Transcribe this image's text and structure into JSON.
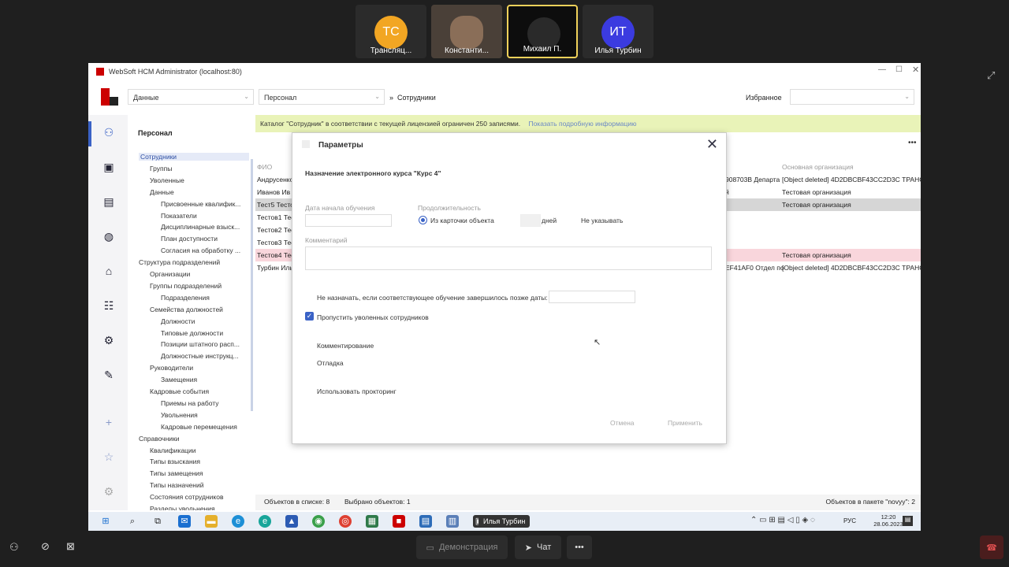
{
  "conference": {
    "participants": [
      {
        "initials": "ТС",
        "name": "Трансляц...",
        "color": "#f2a623"
      },
      {
        "initials": "",
        "name": "Константи...",
        "color": "#555555"
      },
      {
        "initials": "",
        "name": "Михаил П.",
        "color": "#111111"
      },
      {
        "initials": "ИТ",
        "name": "Илья Турбин",
        "color": "#3b3be0"
      }
    ],
    "demo_label": "Демонстрация",
    "chat_label": "Чат",
    "more_label": "•••",
    "taskbar_tooltip": "Илья Турбин"
  },
  "window": {
    "title": "WebSoft HCM Administrator (localhost:80)",
    "toolbar": {
      "data_combo": "Данные",
      "personal_combo": "Персонал",
      "breadcrumb_sep": "»",
      "breadcrumb": "Сотрудники",
      "favorites_label": "Избранное"
    }
  },
  "tree": {
    "header": "Персонал",
    "items": [
      {
        "label": "Сотрудники",
        "level": 0
      },
      {
        "label": "Группы",
        "level": 1
      },
      {
        "label": "Уволенные",
        "level": 1
      },
      {
        "label": "Данные",
        "level": 1
      },
      {
        "label": "Присвоенные квалифик...",
        "level": 2
      },
      {
        "label": "Показатели",
        "level": 2
      },
      {
        "label": "Дисциплинарные взыск...",
        "level": 2
      },
      {
        "label": "План доступности",
        "level": 2
      },
      {
        "label": "Согласия на обработку ...",
        "level": 2
      },
      {
        "label": "Структура подразделений",
        "level": 0
      },
      {
        "label": "Организации",
        "level": 1
      },
      {
        "label": "Группы подразделений",
        "level": 1
      },
      {
        "label": "Подразделения",
        "level": 2
      },
      {
        "label": "Семейства должностей",
        "level": 1
      },
      {
        "label": "Должности",
        "level": 2
      },
      {
        "label": "Типовые должности",
        "level": 2
      },
      {
        "label": "Позиции штатного расп...",
        "level": 2
      },
      {
        "label": "Должностные инструкц...",
        "level": 2
      },
      {
        "label": "Руководители",
        "level": 1
      },
      {
        "label": "Замещения",
        "level": 2
      },
      {
        "label": "Кадровые события",
        "level": 1
      },
      {
        "label": "Приемы на работу",
        "level": 2
      },
      {
        "label": "Увольнения",
        "level": 2
      },
      {
        "label": "Кадровые перемещения",
        "level": 2
      },
      {
        "label": "Справочники",
        "level": 0
      },
      {
        "label": "Квалификации",
        "level": 1
      },
      {
        "label": "Типы взыскания",
        "level": 1
      },
      {
        "label": "Типы замещения",
        "level": 1
      },
      {
        "label": "Типы назначений",
        "level": 1
      },
      {
        "label": "Состояния сотрудников",
        "level": 1
      },
      {
        "label": "Разделы увольнения",
        "level": 1
      }
    ]
  },
  "content": {
    "banner_text": "Каталог \"Сотрудник\" в соответствии с текущей лицензией ограничен 250 записями.",
    "banner_link": "Показать подробную информацию",
    "col_fio": "ФИО",
    "col_org": "Основная организация",
    "rows": [
      {
        "fio": "Андрусенко",
        "mid": "908703B Департа",
        "org": "[Object deleted] 4D2DBCBF43CC2D3C ТРАНС"
      },
      {
        "fio": "Иванов Ив",
        "mid": "й",
        "org": "Тестовая организация"
      },
      {
        "fio": "Тест5 Тесто",
        "mid": "",
        "org": "Тестовая организация"
      },
      {
        "fio": "Тестов1 Тес",
        "mid": "",
        "org": ""
      },
      {
        "fio": "Тестов2 Тес",
        "mid": "",
        "org": ""
      },
      {
        "fio": "Тестов3 Тес",
        "mid": "",
        "org": ""
      },
      {
        "fio": "Тестов4 Тес",
        "mid": "",
        "org": "Тестовая организация"
      },
      {
        "fio": "Турбин Иль",
        "mid": "EF41AF0 Отдел по",
        "org": "[Object deleted] 4D2DBCBF43CC2D3C ТРАНС"
      }
    ],
    "status_count": "Объектов в списке: 8",
    "status_selected": "Выбрано объектов: 1",
    "status_package": "Объектов в пакете \"novyy\": 2"
  },
  "modal": {
    "title": "Параметры",
    "subtitle": "Назначение электронного курса \"Курс 4\"",
    "start_date_label": "Дата начала обучения",
    "duration_label": "Продолжительность",
    "duration_option_card": "Из карточки объекта",
    "days_label": "дней",
    "no_specify_label": "Не указывать",
    "comment_label": "Комментарий",
    "no_assign_label": "Не назначать, если соответствующее обучение завершилось позже даты:",
    "skip_fired_label": "Пропустить уволенных сотрудников",
    "commenting_label": "Комментирование",
    "debug_label": "Отладка",
    "proctoring_label": "Использовать прокторинг",
    "cancel_label": "Отмена",
    "apply_label": "Применить"
  },
  "taskbar": {
    "lang": "РУС",
    "time": "12:20",
    "date": "28.06.2023"
  }
}
